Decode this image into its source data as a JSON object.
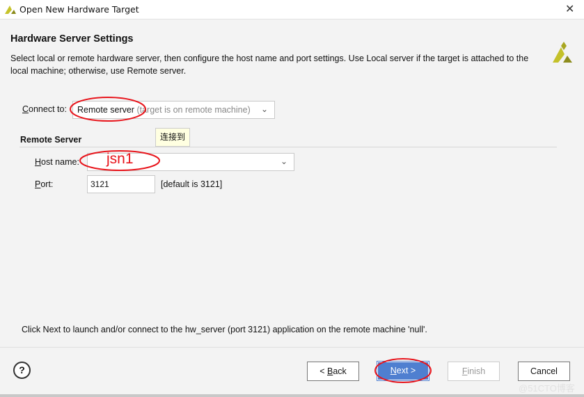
{
  "window": {
    "title": "Open New Hardware Target",
    "close_label": "✕"
  },
  "page": {
    "heading": "Hardware Server Settings",
    "description": "Select local or remote hardware server, then configure the host name and port settings. Use Local server if the target is attached to the local machine; otherwise, use Remote server."
  },
  "connect": {
    "label_first": "C",
    "label_rest": "onnect to:",
    "value": "Remote server",
    "hint": "(target is on remote machine)"
  },
  "tooltip": "连接到",
  "remote": {
    "section": "Remote Server",
    "host_label_first": "H",
    "host_label_rest": "ost name:",
    "host_value": "",
    "port_label_first": "P",
    "port_label_rest": "ort:",
    "port_value": "3121",
    "port_default": "[default is 3121]"
  },
  "annotation": {
    "host_text": "jsn1",
    "color": "#e8141b"
  },
  "info": "Click Next to launch and/or connect to the hw_server (port 3121) application on the remote machine 'null'.",
  "buttons": {
    "help": "?",
    "back_pre": "< ",
    "back_u": "B",
    "back_rest": "ack",
    "next_u": "N",
    "next_rest": "ext >",
    "finish_u": "F",
    "finish_rest": "inish",
    "cancel": "Cancel"
  },
  "colors": {
    "accent": "#4f7fd0",
    "logo": "#b7b81a"
  },
  "watermark": "@51CTO博客"
}
